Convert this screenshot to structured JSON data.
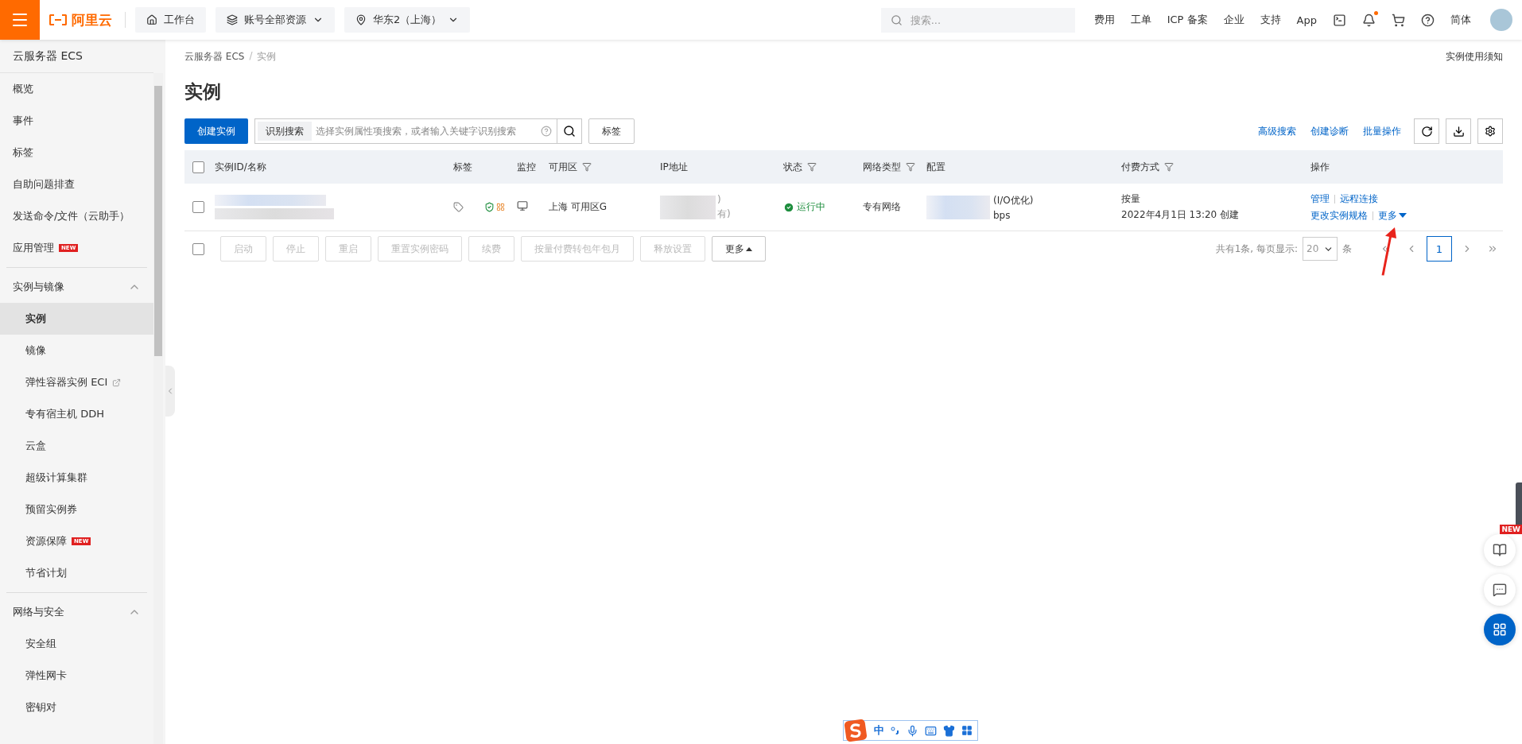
{
  "topbar": {
    "logo": "阿里云",
    "nav": [
      {
        "kind": "home",
        "label": "工作台",
        "dropdown": false
      },
      {
        "kind": "resources",
        "label": "账号全部资源",
        "dropdown": true
      },
      {
        "kind": "region",
        "label": "华东2（上海）",
        "dropdown": true
      }
    ],
    "search": {
      "placeholder": "搜索..."
    },
    "links": [
      "费用",
      "工单",
      "ICP 备案",
      "企业",
      "支持",
      "App"
    ],
    "notification": true,
    "language": "简体"
  },
  "sidebar": {
    "title": "云服务器 ECS",
    "items": [
      {
        "label": "概览",
        "selected": false
      },
      {
        "label": "事件",
        "selected": false
      },
      {
        "label": "标签",
        "selected": false
      },
      {
        "label": "自助问题排查",
        "selected": false
      },
      {
        "label": "发送命令/文件（云助手）",
        "selected": false
      },
      {
        "label": "应用管理",
        "selected": false,
        "badge": "NEW"
      }
    ],
    "sections": [
      {
        "label": "实例与镜像",
        "expanded": true,
        "items": [
          {
            "label": "实例",
            "selected": true,
            "external": false
          },
          {
            "label": "镜像",
            "selected": false,
            "external": false
          },
          {
            "label": "弹性容器实例 ECI",
            "selected": false,
            "external": true
          },
          {
            "label": "专有宿主机 DDH",
            "selected": false,
            "external": false
          },
          {
            "label": "云盒",
            "selected": false,
            "external": false
          },
          {
            "label": "超级计算集群",
            "selected": false,
            "external": false
          },
          {
            "label": "预留实例券",
            "selected": false,
            "external": false
          },
          {
            "label": "资源保障",
            "selected": false,
            "external": false,
            "badge": "NEW"
          },
          {
            "label": "节省计划",
            "selected": false,
            "external": false
          }
        ]
      },
      {
        "label": "网络与安全",
        "expanded": true,
        "items": [
          {
            "label": "安全组",
            "selected": false,
            "external": false
          },
          {
            "label": "弹性网卡",
            "selected": false,
            "external": false
          },
          {
            "label": "密钥对",
            "selected": false,
            "external": false
          }
        ]
      }
    ]
  },
  "breadcrumb": {
    "items": [
      "云服务器 ECS",
      "实例"
    ],
    "separator": "/"
  },
  "notice": "实例使用须知",
  "title": "实例",
  "toolbar": {
    "create": "创建实例",
    "search_prefix": "识别搜索",
    "placeholder": "选择实例属性项搜索，或者输入关键字识别搜索",
    "tag_button": "标签",
    "links": [
      "高级搜索",
      "创建诊断",
      "批量操作"
    ]
  },
  "table": {
    "select_all": false,
    "columns": [
      {
        "label": "实例ID/名称",
        "filter": false
      },
      {
        "label": "标签",
        "filter": false
      },
      {
        "label": "监控",
        "filter": false
      },
      {
        "label": "可用区",
        "filter": true
      },
      {
        "label": "IP地址",
        "filter": false
      },
      {
        "label": "状态",
        "filter": true
      },
      {
        "label": "网络类型",
        "filter": true
      },
      {
        "label": "配置",
        "filter": false
      },
      {
        "label": "付费方式",
        "filter": true
      },
      {
        "label": "操作",
        "filter": false
      }
    ],
    "rows": [
      {
        "checked": false,
        "zone": "上海 可用区G",
        "ip": [
          ")",
          "有)"
        ],
        "status": {
          "kind": "running",
          "label": "运行中"
        },
        "network": "专有网络",
        "config": [
          "(I/O优化)",
          "bps"
        ],
        "billing": "按量",
        "created": "2022年4月1日 13:20 创建",
        "actions": [
          {
            "label": "管理",
            "dropdown": false
          },
          {
            "label": "远程连接",
            "dropdown": false
          },
          {
            "label": "更改实例规格",
            "dropdown": false
          },
          {
            "label": "更多",
            "dropdown": true
          }
        ]
      }
    ]
  },
  "bulk": {
    "checked": false,
    "buttons": [
      {
        "label": "启动",
        "disabled": true
      },
      {
        "label": "停止",
        "disabled": true
      },
      {
        "label": "重启",
        "disabled": true
      },
      {
        "label": "重置实例密码",
        "disabled": true
      },
      {
        "label": "续费",
        "disabled": true
      },
      {
        "label": "按量付费转包年包月",
        "disabled": true
      },
      {
        "label": "释放设置",
        "disabled": true
      },
      {
        "label": "更多",
        "disabled": false,
        "caret": true
      }
    ]
  },
  "pagination": {
    "summary": "共有1条, 每页显示:",
    "page_size": "20",
    "unit": "条",
    "pages": [
      {
        "label": "1",
        "selected": true
      }
    ]
  },
  "float_buttons": [
    {
      "kind": "docs",
      "badge": "NEW"
    },
    {
      "kind": "feedback"
    },
    {
      "kind": "apps"
    }
  ],
  "ime": {
    "mode": "中"
  }
}
